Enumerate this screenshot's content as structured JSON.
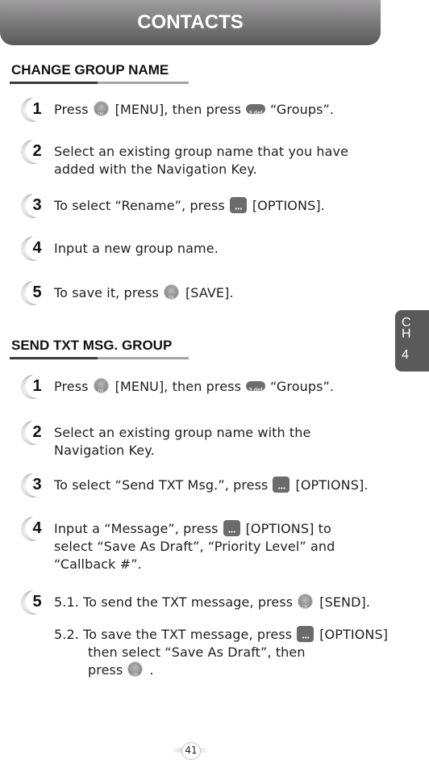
{
  "header": {
    "title": "CONTACTS"
  },
  "chapter_tab": {
    "line1": "C",
    "line2": "H",
    "line3": "4"
  },
  "sections": [
    {
      "title": "CHANGE GROUP NAME",
      "steps": [
        {
          "number": "1",
          "parts": [
            "Press",
            "[MENU], then press",
            "“Groups”."
          ]
        },
        {
          "number": "2",
          "lines": [
            "Select an existing group name that you have",
            "added with the Navigation Key."
          ]
        },
        {
          "number": "3",
          "parts": [
            "To select “Rename”, press",
            "[OPTIONS]."
          ]
        },
        {
          "number": "4",
          "lines": [
            "Input a new group name."
          ]
        },
        {
          "number": "5",
          "parts": [
            "To save it, press",
            "[SAVE]."
          ]
        }
      ]
    },
    {
      "title": "SEND TXT MSG. GROUP",
      "steps": [
        {
          "number": "1",
          "parts": [
            "Press",
            "[MENU], then press",
            "“Groups”."
          ]
        },
        {
          "number": "2",
          "lines": [
            "Select an existing group name with the",
            "Navigation Key."
          ]
        },
        {
          "number": "3",
          "parts": [
            "To select “Send TXT Msg.”, press",
            "[OPTIONS]."
          ]
        },
        {
          "number": "4",
          "parts": [
            "Input a “Message”, press",
            "[OPTIONS] to"
          ],
          "lines": [
            "select “Save As Draft”, “Priority Level” and",
            "“Callback #”."
          ]
        },
        {
          "number": "5",
          "sub1": [
            "5.1. To send the TXT message, press",
            "[SEND]."
          ],
          "sub2": [
            "5.2. To save the TXT message, press",
            "[OPTIONS]"
          ],
          "sub2_lines": [
            "then select “Save As Draft”, then",
            "press",
            "."
          ]
        }
      ]
    }
  ],
  "icons": {
    "ok_key": "ok-key-icon",
    "key_3": "key-3-def-icon",
    "options_key": "options-key-icon"
  },
  "page_number": "41"
}
